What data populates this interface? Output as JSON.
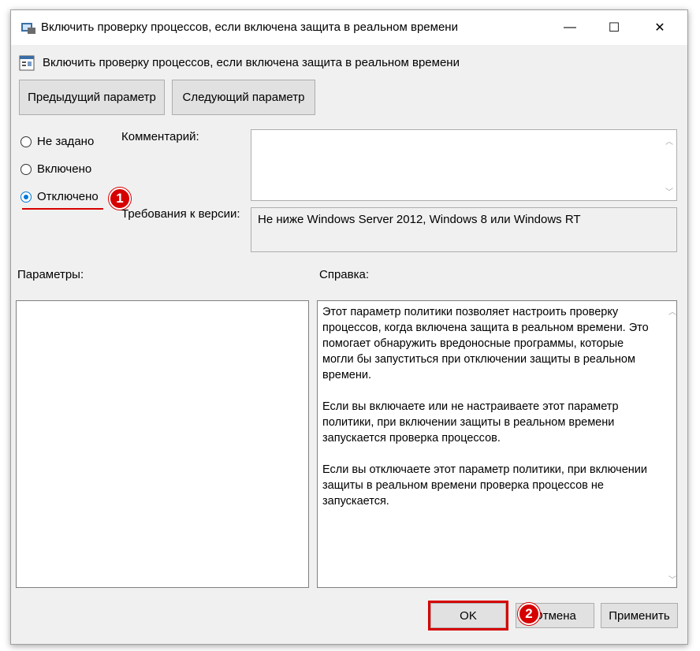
{
  "window": {
    "title": "Включить проверку процессов, если включена защита в реальном времени",
    "controls": {
      "minimize": "—",
      "maximize": "☐",
      "close": "✕"
    }
  },
  "policy": {
    "name": "Включить проверку процессов, если включена защита в реальном времени"
  },
  "nav": {
    "prev_label": "Предыдущий параметр",
    "next_label": "Следующий параметр"
  },
  "state": {
    "options": [
      {
        "label": "Не задано",
        "checked": false
      },
      {
        "label": "Включено",
        "checked": false
      },
      {
        "label": "Отключено",
        "checked": true
      }
    ]
  },
  "fields": {
    "comment_label": "Комментарий:",
    "comment_value": "",
    "version_label": "Требования к версии:",
    "version_value": "Не ниже Windows Server 2012, Windows 8 или Windows RT"
  },
  "sections": {
    "params_label": "Параметры:",
    "help_label": "Справка:"
  },
  "help": {
    "paragraphs": [
      "Этот параметр политики позволяет настроить проверку процессов, когда включена защита в реальном времени. Это помогает обнаружить вредоносные программы, которые могли бы запуститься при отключении защиты в реальном времени.",
      "Если вы включаете или не настраиваете этот параметр политики, при включении защиты в реальном времени запускается проверка процессов.",
      "Если вы отключаете этот параметр политики, при включении защиты в реальном времени проверка процессов не запускается."
    ]
  },
  "footer": {
    "ok_label": "OK",
    "cancel_label": "Отмена",
    "apply_label": "Применить"
  },
  "annotations": {
    "step1": "1",
    "step2": "2",
    "accent_color": "#d60000"
  }
}
